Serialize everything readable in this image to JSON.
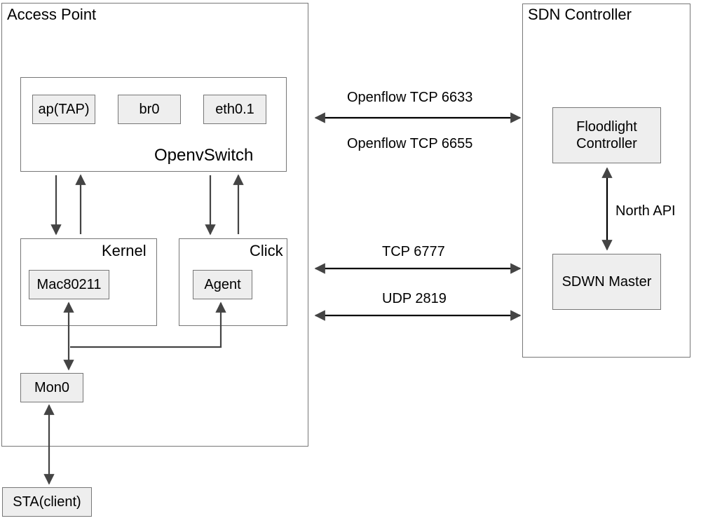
{
  "ap": {
    "title": "Access Point",
    "ovs": {
      "label": "OpenvSwitch",
      "tap": "ap(TAP)",
      "br0": "br0",
      "eth": "eth0.1"
    },
    "kernel": {
      "label": "Kernel",
      "mac": "Mac80211"
    },
    "click": {
      "label": "Click",
      "agent": "Agent"
    },
    "mon0": "Mon0",
    "sta": "STA(client)"
  },
  "ctrl": {
    "title": "SDN Controller",
    "floodlight": "Floodlight Controller",
    "sdwn": "SDWN Master",
    "northapi": "North API"
  },
  "links": {
    "of6633": "Openflow TCP 6633",
    "of6655": "Openflow TCP 6655",
    "tcp6777": "TCP 6777",
    "udp2819": "UDP 2819"
  }
}
